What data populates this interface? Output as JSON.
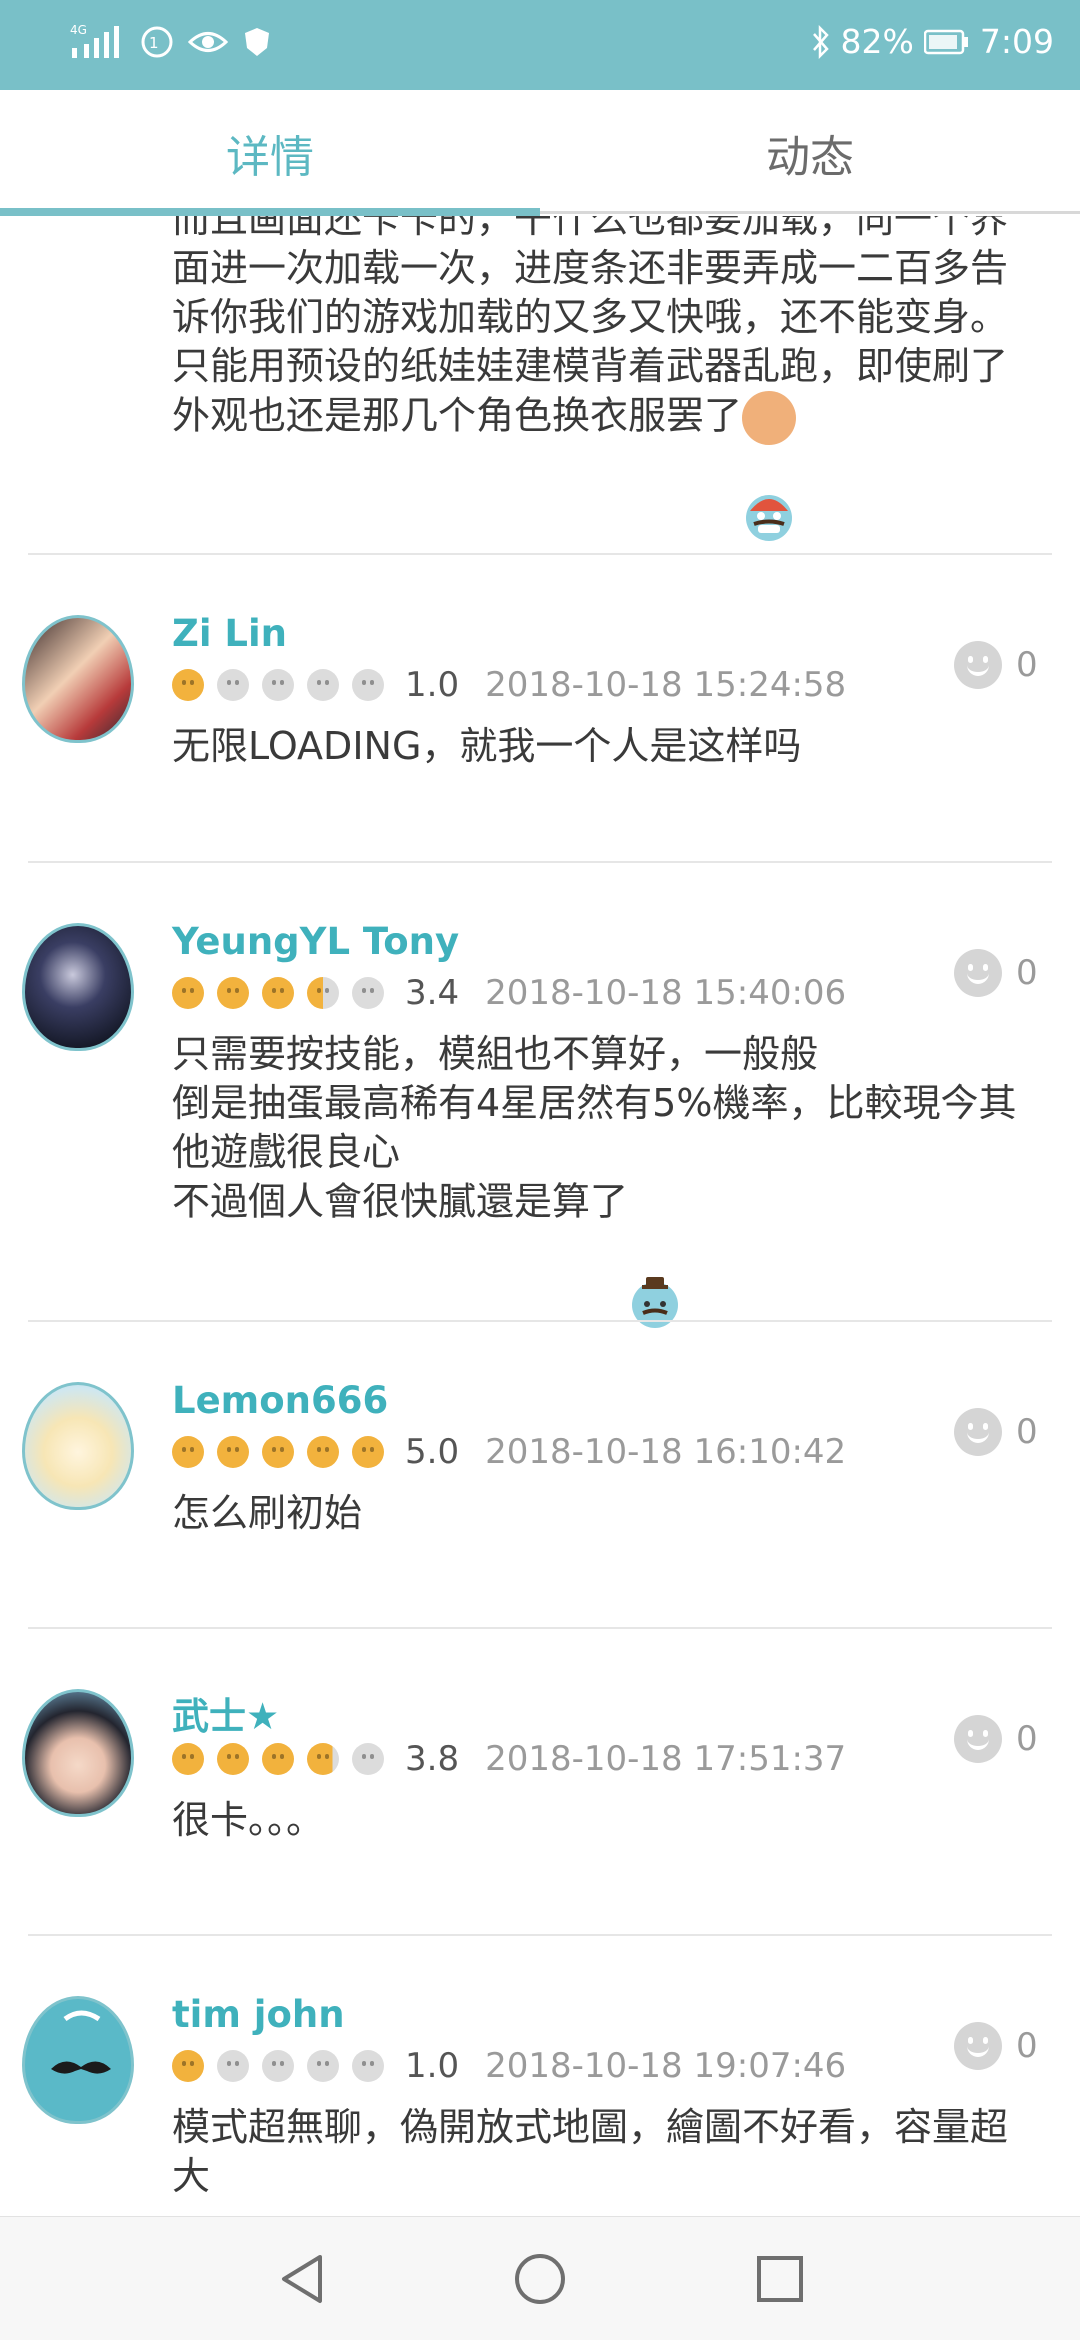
{
  "status_bar": {
    "network": "4G",
    "battery": "82%",
    "time": "7:09"
  },
  "tabs": [
    {
      "label": "详情",
      "active": true
    },
    {
      "label": "动态",
      "active": false
    }
  ],
  "colors": {
    "accent": "#79c0c8",
    "username": "#3fb1bc",
    "star": "#f2b23d"
  },
  "top_review": {
    "text": "而且画面还卡卡的，干什么也都要加载，同一个界面进一次加载一次，进度条还非要弄成一二百多告诉你我们的游戏加载的又多又快哦，还不能变身。\n只能用预设的纸娃娃建模背着武器乱跑，即使刷了外观也还是那几个角色换衣服罢了",
    "emoji": "angry-emoji"
  },
  "reviews": [
    {
      "username": "Zi Lin",
      "rating": 1.0,
      "score": "1.0",
      "date": "2018-10-18 15:24:58",
      "likes": "0",
      "text": "无限LOADING，就我一个人是这样吗",
      "avatar": "anime-girls-avatar"
    },
    {
      "username": "YeungYL Tony",
      "rating": 3.4,
      "score": "3.4",
      "date": "2018-10-18 15:40:06",
      "likes": "0",
      "text": "只需要按技能，模組也不算好，一般般\n倒是抽蛋最高稀有4星居然有5%機率，比較現今其他遊戲很良心\n不過個人會很快膩還是算了",
      "avatar": "dark-rider-avatar",
      "emoji": "sweat-emoji"
    },
    {
      "username": "Lemon666",
      "rating": 5.0,
      "score": "5.0",
      "date": "2018-10-18 16:10:42",
      "likes": "0",
      "text": "怎么刷初始",
      "avatar": "blonde-chibi-avatar"
    },
    {
      "username": "武士★",
      "rating": 3.8,
      "score": "3.8",
      "date": "2018-10-18 17:51:37",
      "likes": "0",
      "text": "很卡。。。",
      "avatar": "dark-hair-girl-avatar"
    },
    {
      "username": "tim john",
      "rating": 1.0,
      "score": "1.0",
      "date": "2018-10-18 19:07:46",
      "likes": "0",
      "text": "模式超無聊，偽開放式地圖，繪圖不好看，容量超大",
      "avatar": "mustache-avatar"
    }
  ],
  "nav": {
    "back": "back-icon",
    "home": "home-icon",
    "recents": "recents-icon"
  }
}
